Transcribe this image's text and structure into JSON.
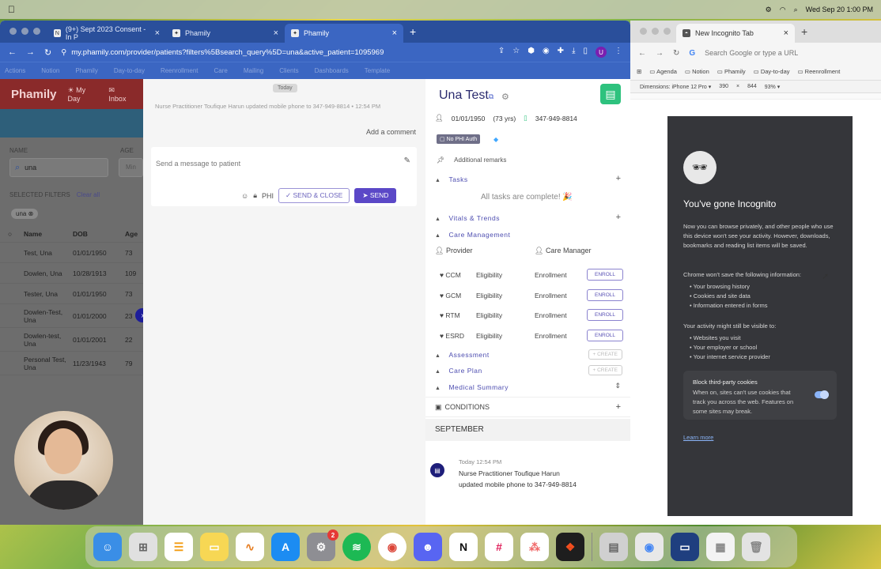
{
  "menubar": {
    "datetime": "Wed Sep 20  1:00 PM"
  },
  "browser": {
    "tabs": [
      {
        "label": "(9+) Sept 2023 Consent - In P",
        "icon": "N"
      },
      {
        "label": "Phamily",
        "icon": "✦"
      },
      {
        "label": "Phamily",
        "icon": "✦"
      }
    ],
    "url": "my.phamily.com/provider/patients?filters%5Bsearch_query%5D=una&active_patient=1095969",
    "avatar": "U",
    "bookmarks": [
      "Actions",
      "Notion",
      "Phamily",
      "Day-to-day",
      "Reenrollment",
      "Care",
      "Mailing",
      "Clients",
      "Dashboards",
      "Template"
    ]
  },
  "app": {
    "logo": "Phamily",
    "nav": [
      {
        "label": "My Day"
      },
      {
        "label": "Inbox"
      }
    ],
    "filters": {
      "name_label": "NAME",
      "age_label": "AGE",
      "search_value": "una",
      "age_placeholder": "Min",
      "selected_label": "SELECTED FILTERS",
      "clear_all": "Clear all",
      "chip": "una"
    },
    "table": {
      "headers": [
        "Name",
        "DOB",
        "Age"
      ],
      "rows": [
        {
          "name": "Test, Una",
          "dob": "01/01/1950",
          "age": "73"
        },
        {
          "name": "Dowlen, Una",
          "dob": "10/28/1913",
          "age": "109"
        },
        {
          "name": "Tester, Una",
          "dob": "01/01/1950",
          "age": "73"
        },
        {
          "name": "Dowlen-Test, Una",
          "dob": "01/01/2000",
          "age": "23"
        },
        {
          "name": "Dowlen-test, Una",
          "dob": "01/01/2001",
          "age": "22"
        },
        {
          "name": "Personal Test, Una",
          "dob": "11/23/1943",
          "age": "79"
        }
      ]
    }
  },
  "messages": {
    "today_badge": "Today",
    "notice": "Nurse Practitioner Toufique Harun updated mobile phone to 347-949-8814 • 12:54 PM",
    "add_comment": "Add a comment",
    "compose_placeholder": "Send a message to patient",
    "phi": "PHI",
    "send_close": "SEND & CLOSE",
    "send": "SEND"
  },
  "patient": {
    "name": "Una Test",
    "dob": "01/01/1950",
    "age": "(73 yrs)",
    "phone": "347-949-8814",
    "badge": "No PHI Auth",
    "remarks": "Additional remarks",
    "tasks_label": "Tasks",
    "tasks_done": "All tasks are complete! 🎉",
    "vitals_label": "Vitals & Trends",
    "care_mgmt_label": "Care Management",
    "provider_label": "Provider",
    "care_manager_label": "Care Manager",
    "programs": [
      {
        "name": "CCM",
        "eligibility": "Eligibility",
        "enrollment": "Enrollment",
        "action": "ENROLL"
      },
      {
        "name": "GCM",
        "eligibility": "Eligibility",
        "enrollment": "Enrollment",
        "action": "ENROLL"
      },
      {
        "name": "RTM",
        "eligibility": "Eligibility",
        "enrollment": "Enrollment",
        "action": "ENROLL"
      },
      {
        "name": "ESRD",
        "eligibility": "Eligibility",
        "enrollment": "Enrollment",
        "action": "ENROLL"
      }
    ],
    "assessment_label": "Assessment",
    "care_plan_label": "Care Plan",
    "create": "CREATE",
    "medical_summary_label": "Medical Summary",
    "conditions_label": "CONDITIONS",
    "month": "SEPTEMBER",
    "event_time": "Today 12:54 PM",
    "event_author": "Nurse Practitioner Toufique Harun",
    "event_text": "updated mobile phone to 347-949-8814"
  },
  "incognito": {
    "tab_label": "New Incognito Tab",
    "omnibox_placeholder": "Search Google or type a URL",
    "bookmarks": [
      "Agenda",
      "Notion",
      "Phamily",
      "Day-to-day",
      "Reenrollment"
    ],
    "device": "Dimensions: iPhone 12 Pro ▾",
    "width": "390",
    "height": "844",
    "zoom": "93% ▾",
    "title": "You've gone Incognito",
    "para": "Now you can browse privately, and other people who use this device won't see your activity. However, downloads, bookmarks and reading list items will be saved.",
    "wont_save": "Chrome won't save the following information:",
    "wont_items": [
      "Your browsing history",
      "Cookies and site data",
      "Information entered in forms"
    ],
    "visible": "Your activity might still be visible to:",
    "visible_items": [
      "Websites you visit",
      "Your employer or school",
      "Your internet service provider"
    ],
    "cookie_title": "Block third-party cookies",
    "cookie_text": "When on, sites can't use cookies that track you across the web. Features on some sites may break.",
    "learn_more": "Learn more"
  },
  "dock": {
    "badge_count": "2",
    "colors": {
      "finder": "#3a8ee6",
      "launchpad": "#e0e0e0",
      "reminders": "#ffffff",
      "notes": "#f7d754",
      "freeform": "#ffffff",
      "appstore": "#1c8cf2",
      "settings": "#8e8e93",
      "spotify": "#1db954",
      "chrome": "#ffffff",
      "discord": "#5865f2",
      "notion": "#ffffff",
      "slack": "#ffffff",
      "asana": "#ffffff",
      "figma": "#1e1e1e"
    }
  },
  "colors": {
    "brand": "#5b48c7",
    "header": "#3b66c2",
    "navy": "#2a2a6e",
    "green": "#2ec27e"
  }
}
